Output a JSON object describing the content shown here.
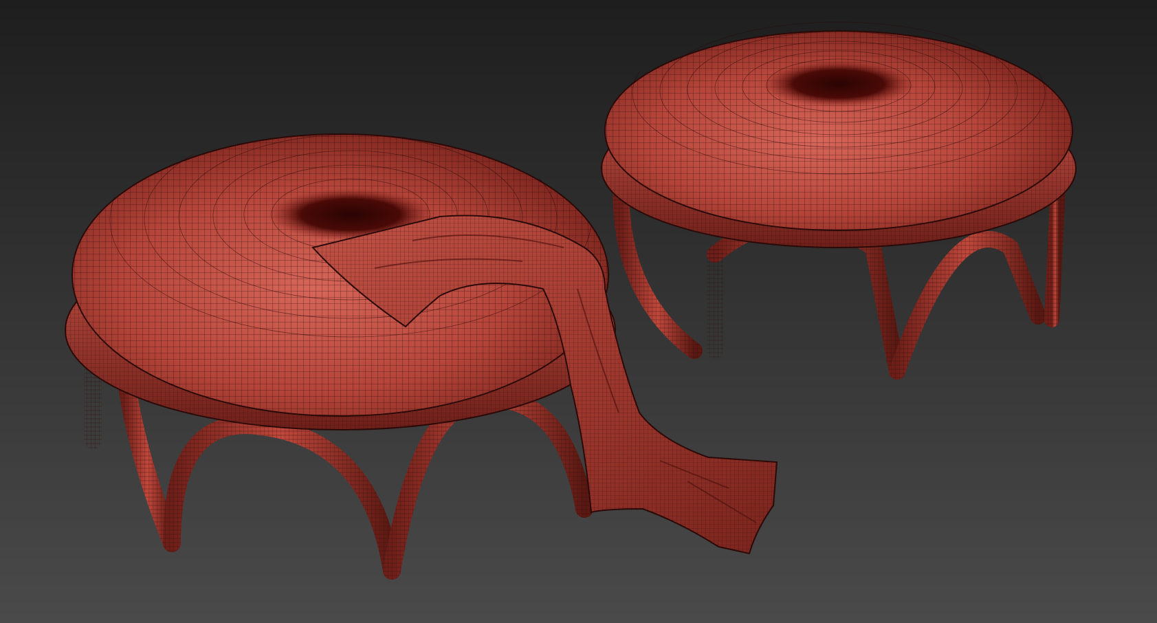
{
  "scene": {
    "description_visible_text": "",
    "objects": [
      {
        "name": "ottoman-left",
        "has_throw": true
      },
      {
        "name": "ottoman-right",
        "has_throw": false
      }
    ]
  },
  "colors": {
    "background_top": "#1e1e1e",
    "background_bottom": "#4a4a4a",
    "mesh_fill": "#b5453a",
    "mesh_fill_light": "#cf5f52",
    "mesh_fill_dark": "#6e1f19",
    "wire": "#2a0a08",
    "hole_dark": "#3a0705"
  }
}
